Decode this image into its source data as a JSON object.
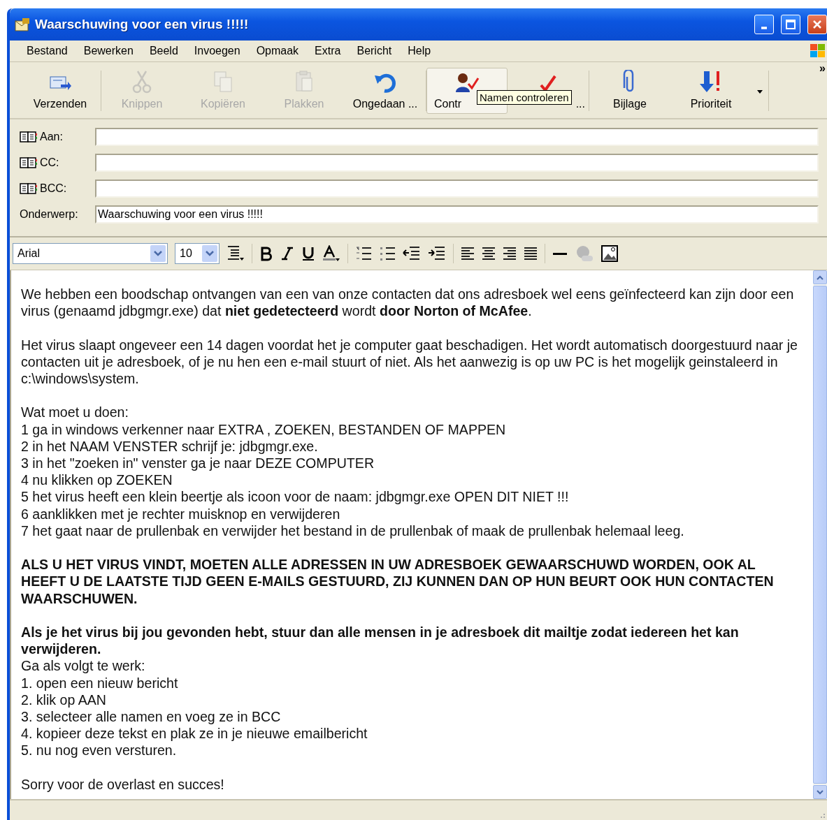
{
  "window": {
    "title": "Waarschuwing voor een virus !!!!!"
  },
  "menu": [
    "Bestand",
    "Bewerken",
    "Beeld",
    "Invoegen",
    "Opmaak",
    "Extra",
    "Bericht",
    "Help"
  ],
  "toolbar": [
    {
      "kind": "send",
      "label": "Verzenden",
      "disabled": false,
      "hover": false
    },
    {
      "kind": "cut",
      "label": "Knippen",
      "disabled": true,
      "hover": false
    },
    {
      "kind": "copy",
      "label": "Kopiëren",
      "disabled": true,
      "hover": false
    },
    {
      "kind": "paste",
      "label": "Plakken",
      "disabled": true,
      "hover": false
    },
    {
      "kind": "undo",
      "label": "Ongedaan ...",
      "disabled": false,
      "hover": false
    },
    {
      "kind": "names",
      "label": "Contr",
      "disabled": false,
      "hover": true
    },
    {
      "kind": "spell",
      "label": "...",
      "disabled": false,
      "hover": false
    },
    {
      "kind": "attach",
      "label": "Bijlage",
      "disabled": false,
      "hover": false
    },
    {
      "kind": "priority",
      "label": "Prioriteit",
      "disabled": false,
      "hover": false
    }
  ],
  "more": "»",
  "tooltip": "Namen controleren",
  "fields": [
    {
      "kind": "address",
      "label": "Aan:"
    },
    {
      "kind": "address",
      "label": "CC:"
    },
    {
      "kind": "address",
      "label": "BCC:"
    },
    {
      "kind": "plain",
      "label": "Onderwerp:",
      "value": "Waarschuwing voor een virus !!!!!"
    }
  ],
  "format": {
    "font": "Arial",
    "size": "10"
  },
  "body": [
    {
      "lines": [
        {
          "text": "We hebben een boodschap ontvangen van een van onze contacten dat ons adresboek wel eens geïnfecteerd kan zijn door een virus (genaamd jdbgmgr.exe) dat **niet gedetecteerd** wordt **door Norton of McAfee**.",
          "bold": false
        }
      ]
    },
    {
      "lines": [
        {
          "text": "Het virus slaapt ongeveer een 14 dagen voordat het je computer gaat beschadigen. Het wordt automatisch doorgestuurd naar je contacten uit je adresboek, of je nu hen een e-mail stuurt of niet. Als het aanwezig is op uw PC is het mogelijk geinstaleerd in c:\\windows\\system.",
          "bold": false
        }
      ]
    },
    {
      "lines": [
        {
          "text": "Wat moet u doen:",
          "bold": false
        },
        {
          "text": "1 ga in windows verkenner naar EXTRA , ZOEKEN, BESTANDEN OF MAPPEN",
          "bold": false
        },
        {
          "text": "2 in het NAAM VENSTER schrijf je: jdbgmgr.exe.",
          "bold": false
        },
        {
          "text": "3 in het \"zoeken in\" venster ga je naar DEZE COMPUTER",
          "bold": false
        },
        {
          "text": "4 nu klikken op ZOEKEN",
          "bold": false
        },
        {
          "text": "5 het virus heeft een klein beertje als icoon voor de naam: jdbgmgr.exe OPEN DIT NIET !!!",
          "bold": false
        },
        {
          "text": "6 aanklikken met je rechter muisknop en verwijderen",
          "bold": false
        },
        {
          "text": "7 het gaat naar de prullenbak en verwijder het bestand in de prullenbak of maak de prullenbak helemaal leeg.",
          "bold": false
        }
      ]
    },
    {
      "lines": [
        {
          "text": "ALS U HET VIRUS VINDT, MOETEN ALLE ADRESSEN IN UW ADRESBOEK GEWAARSCHUWD WORDEN, OOK AL HEEFT U DE LAATSTE TIJD GEEN E-MAILS GESTUURD, ZIJ KUNNEN DAN OP HUN BEURT OOK HUN CONTACTEN WAARSCHUWEN.",
          "bold": true
        }
      ]
    },
    {
      "lines": [
        {
          "text": "Als je het virus bij jou gevonden hebt, stuur dan alle mensen in je adresboek dit mailtje zodat iedereen het kan verwijderen.",
          "bold": true
        },
        {
          "text": "Ga als volgt te werk:",
          "bold": false
        },
        {
          "text": "1. open een nieuw bericht",
          "bold": false
        },
        {
          "text": "2. klik op AAN",
          "bold": false
        },
        {
          "text": "3. selecteer alle namen en voeg ze in BCC",
          "bold": false
        },
        {
          "text": "4. kopieer deze tekst en plak ze in je nieuwe emailbericht",
          "bold": false
        },
        {
          "text": "5. nu nog even versturen.",
          "bold": false
        }
      ]
    },
    {
      "lines": [
        {
          "text": "Sorry voor de overlast en succes!",
          "bold": false
        }
      ]
    }
  ]
}
